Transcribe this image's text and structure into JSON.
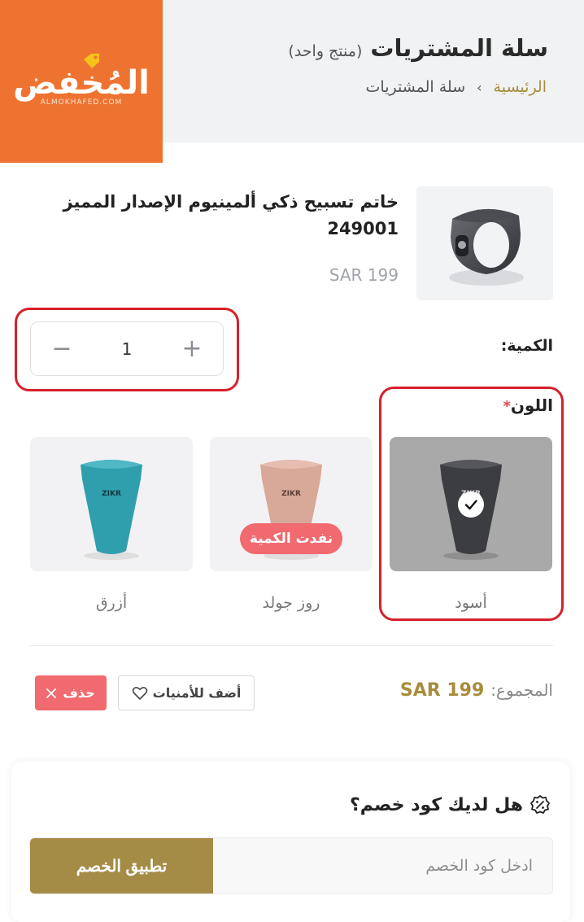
{
  "header": {
    "logo_text": "المُخفض",
    "logo_sub": "ALMOKHAFED.COM",
    "page_title": "سلة المشتريات",
    "page_count": "(منتج واحد)",
    "breadcrumb": {
      "home": "الرئيسية",
      "separator": "›",
      "current": "سلة المشتريات"
    }
  },
  "product": {
    "name": "خاتم تسبيح ذكي ألمينيوم الإصدار المميز 249001",
    "price": "SAR 199",
    "image_icon": "smart-ring-image"
  },
  "quantity": {
    "label": "الكمية:",
    "value": "1",
    "minus": "−",
    "plus": "+"
  },
  "color": {
    "label": "اللون",
    "required_mark": "*",
    "options": [
      {
        "name": "أسود",
        "selected": true,
        "out_of_stock": false,
        "ring_color": "#3c3d40",
        "brand": "ZIKR"
      },
      {
        "name": "روز جولد",
        "selected": false,
        "out_of_stock": true,
        "badge": "نفدت الكمية",
        "ring_color": "#d8a898",
        "brand": "ZIKR"
      },
      {
        "name": "أزرق",
        "selected": false,
        "out_of_stock": false,
        "ring_color": "#2f9fae",
        "brand": "ZIKR"
      }
    ]
  },
  "totals": {
    "label": "المجموع:",
    "value": "SAR 199"
  },
  "actions": {
    "wishlist": "أضف للأمنيات",
    "delete": "حذف"
  },
  "coupon": {
    "title": "هل لديك كود خصم؟",
    "placeholder": "ادخل كود الخصم",
    "apply": "تطبيق الخصم"
  },
  "colors": {
    "accent": "#a88c3c",
    "brand_orange": "#ef7330",
    "danger": "#f06a6f",
    "highlight": "#d6202b"
  }
}
